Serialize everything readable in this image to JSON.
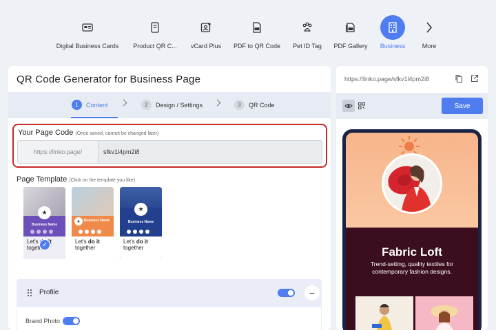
{
  "nav": {
    "items": [
      {
        "label": "Digital Business Cards",
        "icon": "id-card-icon"
      },
      {
        "label": "Product QR C...",
        "icon": "product-box-icon"
      },
      {
        "label": "vCard Plus",
        "icon": "vcard-icon"
      },
      {
        "label": "PDF to QR Code",
        "icon": "pdf-icon"
      },
      {
        "label": "Pet ID Tag",
        "icon": "paw-icon"
      },
      {
        "label": "PDF Gallery",
        "icon": "pdf-gallery-icon"
      },
      {
        "label": "Business",
        "icon": "building-icon",
        "active": true
      },
      {
        "label": "More",
        "icon": "chevron-right-icon"
      }
    ],
    "accent": "#4f7df0"
  },
  "page": {
    "title": "QR Code Generator for Business Page"
  },
  "steps": [
    {
      "num": "1",
      "label": "Content",
      "active": true
    },
    {
      "num": "2",
      "label": "Design / Settings"
    },
    {
      "num": "3",
      "label": "QR Code"
    }
  ],
  "page_code": {
    "title": "Your Page Code",
    "hint": "(Once saved, cannot be changed later)",
    "prefix": "https://linko.page/",
    "value": "sfkv1l4pm2i8"
  },
  "templates": {
    "title": "Page Template",
    "hint": "(Click on the template you like)",
    "items": [
      {
        "name": "Business Name",
        "promo_a": "Let's ",
        "promo_b": "do it",
        "promo_c": "together",
        "selected": true
      },
      {
        "name": "Business Name",
        "promo_a": "Let's ",
        "promo_b": "do it",
        "promo_c": "together"
      },
      {
        "name": "Business Name",
        "promo_a": "Let's ",
        "promo_b": "do it",
        "promo_c": "together"
      }
    ]
  },
  "profile": {
    "label": "Profile",
    "enabled": true,
    "brand_photo_label": "Brand Photo",
    "brand_photo_enabled": true
  },
  "preview": {
    "url": "https://linko.page/sfkv1l4pm2i8",
    "save_label": "Save",
    "business_title": "Fabric Loft",
    "business_sub": "Trend-setting, quality textiles for contemporary fashion designs."
  }
}
